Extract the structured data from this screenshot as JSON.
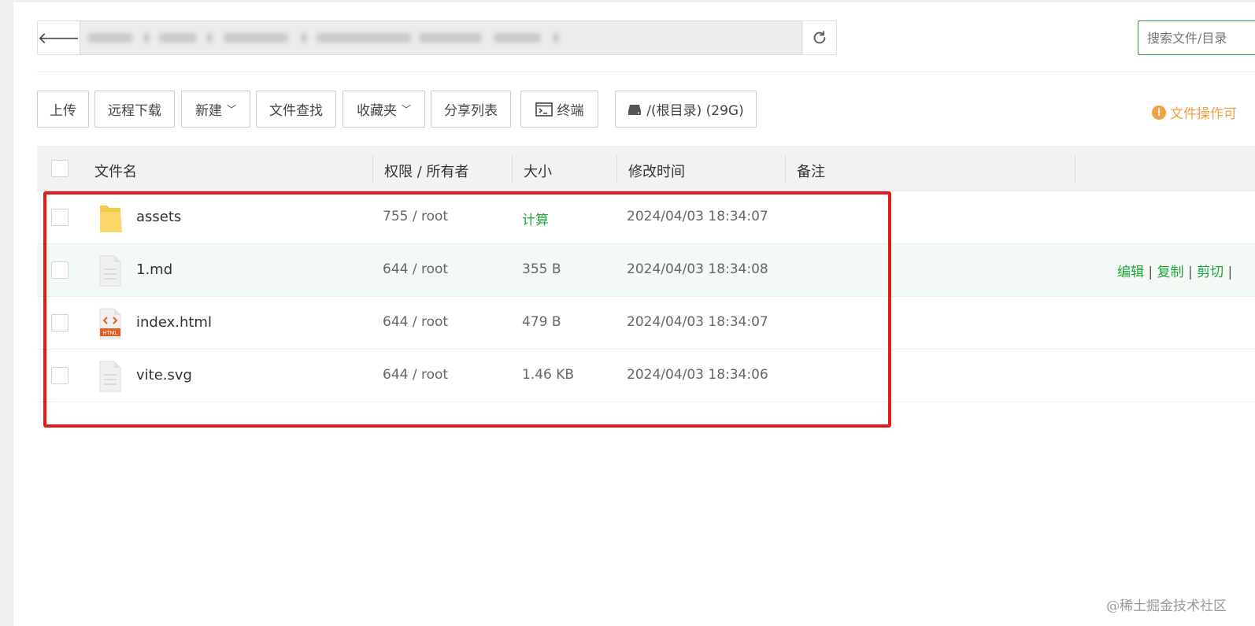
{
  "address_bar": {
    "back_icon": "arrow-left-icon",
    "refresh_icon": "refresh-icon"
  },
  "search": {
    "placeholder": "搜索文件/目录"
  },
  "toolbar": {
    "upload": "上传",
    "remote_download": "远程下载",
    "new": "新建",
    "file_search": "文件查找",
    "favorites": "收藏夹",
    "share_list": "分享列表",
    "terminal": "终端",
    "disk": "/(根目录) (29G)",
    "ops_tip": "文件操作可"
  },
  "table": {
    "headers": {
      "name": "文件名",
      "permission": "权限 / 所有者",
      "size": "大小",
      "modified": "修改时间",
      "remark": "备注"
    },
    "rows": [
      {
        "name": "assets",
        "permission": "755 / root",
        "size": "计算",
        "modified": "2024/04/03 18:34:07",
        "type": "folder",
        "icon": "folder-icon"
      },
      {
        "name": "1.md",
        "permission": "644 / root",
        "size": "355 B",
        "modified": "2024/04/03 18:34:08",
        "type": "file",
        "icon": "file-icon"
      },
      {
        "name": "index.html",
        "permission": "644 / root",
        "size": "479 B",
        "modified": "2024/04/03 18:34:07",
        "type": "html",
        "icon": "html-file-icon",
        "icon_label": "HTML"
      },
      {
        "name": "vite.svg",
        "permission": "644 / root",
        "size": "1.46 KB",
        "modified": "2024/04/03 18:34:06",
        "type": "file",
        "icon": "file-icon"
      }
    ],
    "row_actions": {
      "edit": "编辑",
      "copy": "复制",
      "cut": "剪切",
      "separator": "|"
    }
  },
  "watermark": "@稀土掘金技术社区",
  "colors": {
    "accent": "#20a53a",
    "warning": "#f0a040",
    "highlight": "#e21b1b",
    "folder": "#f5c94a",
    "html_icon": "#e65a24"
  }
}
